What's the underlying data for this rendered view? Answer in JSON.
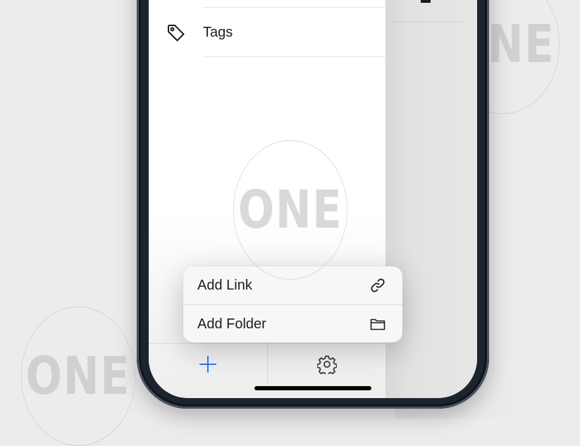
{
  "sidebar": {
    "items": [
      {
        "label": "Tags",
        "icon": "tag-icon"
      }
    ]
  },
  "context_menu": {
    "items": [
      {
        "label": "Add Link",
        "icon": "link-icon"
      },
      {
        "label": "Add Folder",
        "icon": "folder-icon"
      }
    ]
  },
  "toolbar": {
    "add_icon": "plus-icon",
    "settings_icon": "gear-icon"
  },
  "watermark": {
    "text": "ONE"
  },
  "colors": {
    "accent": "#2f7bf5",
    "text": "#1c1c1e",
    "menu_bg": "#f7f7f7",
    "phone_frame": "#1e2330"
  }
}
